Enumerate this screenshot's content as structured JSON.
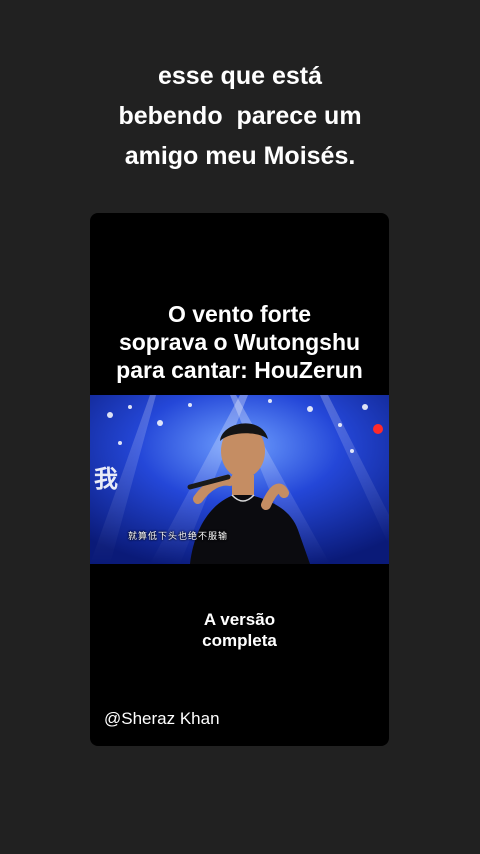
{
  "caption": {
    "line1": "esse que está",
    "line2": "bebendo  parece um",
    "line3": "amigo meu Moisés."
  },
  "video": {
    "title_line1": "O vento forte",
    "title_line2": "soprava o Wutongshu",
    "title_line3": "para cantar: HouZerun",
    "subtitle": "就算低下头也绝不服输",
    "cta_line1": "A versão",
    "cta_line2": "completa",
    "handle": "@Sheraz Khan"
  },
  "colors": {
    "background": "#212121",
    "card": "#000000",
    "stage_blue": "#1a3fd6",
    "text": "#ffffff"
  }
}
